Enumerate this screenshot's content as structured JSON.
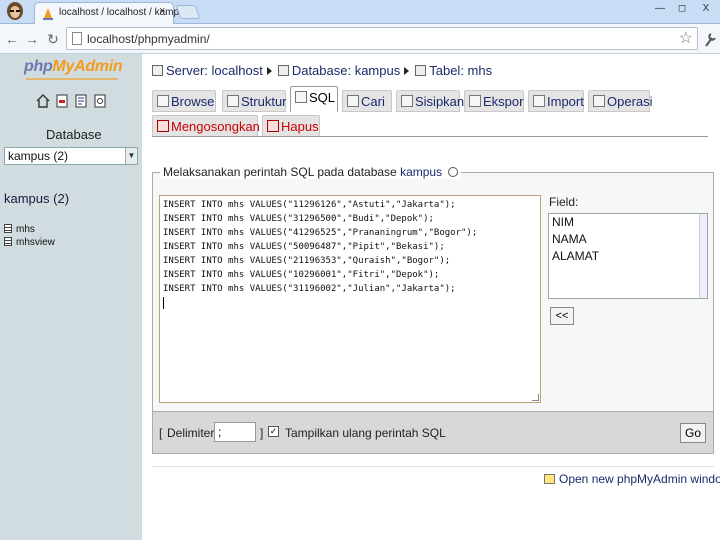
{
  "browser": {
    "tab_title": "localhost / localhost / kampus",
    "tab_close": "×",
    "url": "localhost/phpmyadmin/",
    "minimize": "—",
    "restore": "◻",
    "close": "X"
  },
  "logo": {
    "php": "php",
    "my": "My",
    "admin": "Admin"
  },
  "sidebar": {
    "database_label": "Database",
    "database_select": "kampus (2)",
    "db_heading": "kampus (2)",
    "tables": [
      "mhs",
      "mhsview"
    ]
  },
  "breadcrumb": {
    "server": "Server: localhost",
    "database": "Database: kampus",
    "table": "Tabel: mhs"
  },
  "tabs": {
    "browse": "Browse",
    "struktur": "Struktur",
    "sql": "SQL",
    "cari": "Cari",
    "sisipkan": "Sisipkan",
    "ekspor": "Ekspor",
    "import": "Import",
    "operasi": "Operasi",
    "mengosongkan": "Mengosongkan",
    "hapus": "Hapus"
  },
  "query_panel": {
    "legend_prefix": "Melaksanakan perintah SQL pada database ",
    "legend_db": "kampus",
    "sql_lines": [
      "INSERT INTO mhs VALUES(\"11296126\",\"Astuti\",\"Jakarta\");",
      "INSERT INTO mhs VALUES(\"31296500\",\"Budi\",\"Depok\");",
      "INSERT INTO mhs VALUES(\"41296525\",\"Prananingrum\",\"Bogor\");",
      "INSERT INTO mhs VALUES(\"50096487\",\"Pipit\",\"Bekasi\");",
      "INSERT INTO mhs VALUES(\"21196353\",\"Quraish\",\"Bogor\");",
      "INSERT INTO mhs VALUES(\"10296001\",\"Fitri\",\"Depok\");",
      "INSERT INTO mhs VALUES(\"31196002\",\"Julian\",\"Jakarta\");"
    ],
    "field_label": "Field:",
    "fields": [
      "NIM",
      "NAMA",
      "ALAMAT"
    ],
    "insert_button": "<<"
  },
  "bottom_bar": {
    "bracket_open": "[",
    "delimiter_label": "Delimiter",
    "delimiter_value": ";",
    "bracket_close": "]",
    "checkbox_mark": "✓",
    "show_query_label": "Tampilkan ulang perintah SQL",
    "go_button": "Go"
  },
  "footer": {
    "open_window": "Open new phpMyAdmin window"
  }
}
